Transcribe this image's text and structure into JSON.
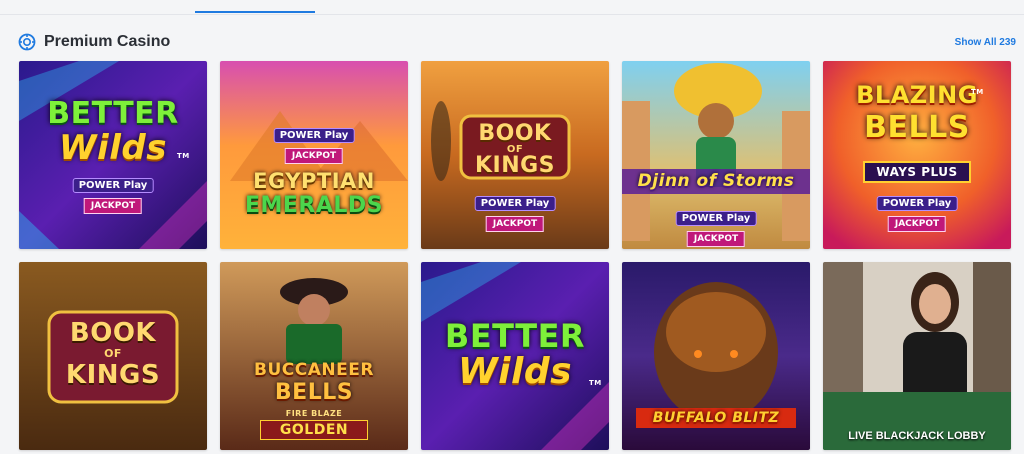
{
  "section": {
    "title": "Premium Casino",
    "icon": "casino-chip-icon",
    "show_all": "Show All 239"
  },
  "games": [
    {
      "name": "better-wilds-power-play-jackpot",
      "line1": "BETTER",
      "line2": "Wilds",
      "badge_power": "POWER Play",
      "badge_jackpot": "JACKPOT",
      "tm": "TM"
    },
    {
      "name": "egyptian-emeralds-power-play-jackpot",
      "badge_power": "POWER Play",
      "badge_jackpot": "JACKPOT",
      "line1": "EGYPTIAN",
      "line2": "EMERALDS"
    },
    {
      "name": "book-of-kings-power-play-jackpot",
      "line1": "BOOK",
      "line2": "OF",
      "line3": "KINGS",
      "badge_power": "POWER Play",
      "badge_jackpot": "JACKPOT"
    },
    {
      "name": "djinn-of-storms-power-play-jackpot",
      "line1": "Djinn of Storms",
      "badge_power": "POWER Play",
      "badge_jackpot": "JACKPOT"
    },
    {
      "name": "blazing-bells-ways-plus-power-play-jackpot",
      "line1": "BLAZING",
      "line2": "BELLS",
      "line3": "WAYS PLUS",
      "badge_power": "POWER Play",
      "badge_jackpot": "JACKPOT",
      "tm": "TM"
    },
    {
      "name": "book-of-kings",
      "line1": "BOOK",
      "line2": "OF",
      "line3": "KINGS"
    },
    {
      "name": "buccaneer-bells-fire-blaze-golden",
      "line1": "BUCCANEER",
      "line2": "BELLS",
      "line3": "FIRE BLAZE",
      "line4": "GOLDEN"
    },
    {
      "name": "better-wilds",
      "line1": "BETTER",
      "line2": "Wilds",
      "tm": "TM"
    },
    {
      "name": "buffalo-blitz",
      "line1": "BUFFALO BLITZ"
    },
    {
      "name": "live-blackjack-lobby",
      "caption": "LIVE BLACKJACK LOBBY"
    }
  ],
  "colors": {
    "accent": "#1f7ae0",
    "title": "#2b2f36",
    "background": "#f4f5f7"
  }
}
